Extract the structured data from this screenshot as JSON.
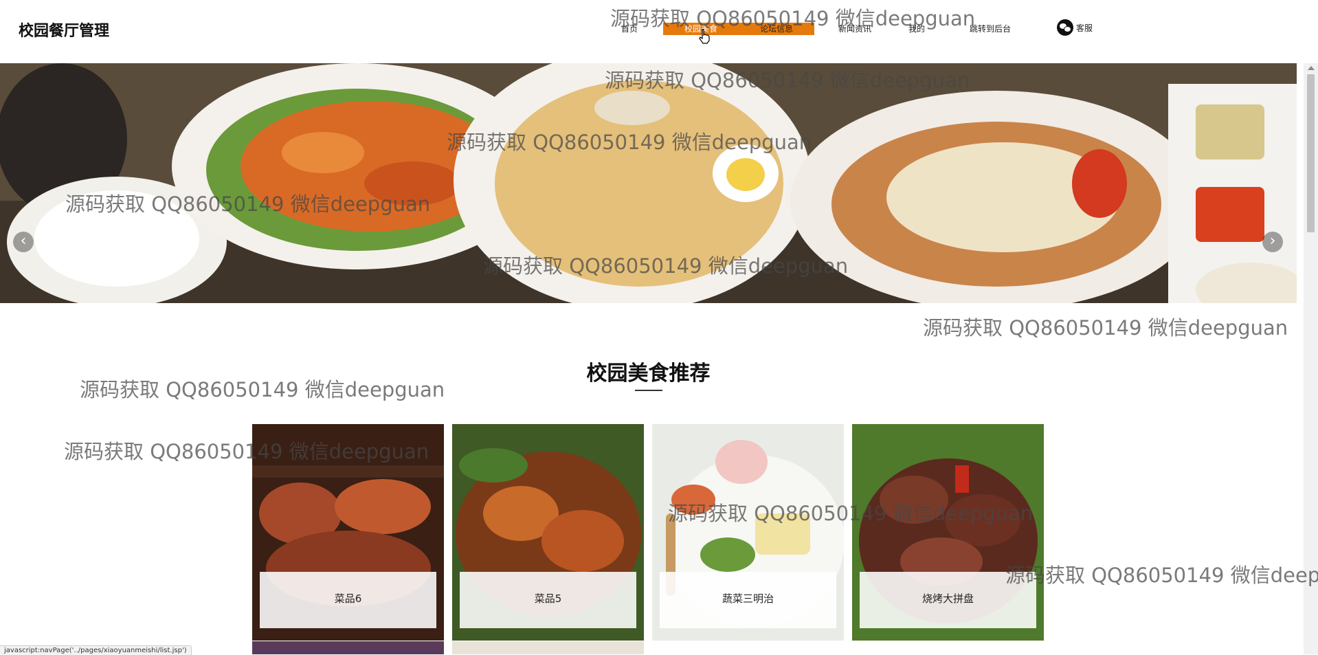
{
  "header": {
    "brand": "校园餐厅管理",
    "nav": [
      {
        "label": "首页"
      },
      {
        "label": "校园美食"
      },
      {
        "label": "论坛信息"
      },
      {
        "label": "新闻资讯"
      },
      {
        "label": "我的"
      },
      {
        "label": "跳转到后台"
      }
    ],
    "service_label": "客服"
  },
  "carousel": {
    "prev_icon": "chevron-left-icon",
    "next_icon": "chevron-right-icon",
    "slide_count": 3,
    "active_slide": 1
  },
  "section": {
    "title": "校园美食推荐"
  },
  "foods": [
    {
      "name": "菜品6"
    },
    {
      "name": "菜品5"
    },
    {
      "name": "蔬菜三明治"
    },
    {
      "name": "烧烤大拼盘"
    }
  ],
  "watermark": "源码获取 QQ86050149 微信deepguan",
  "status_text": "javascript:navPage('../pages/xiaoyuanmeishi/list.jsp')"
}
